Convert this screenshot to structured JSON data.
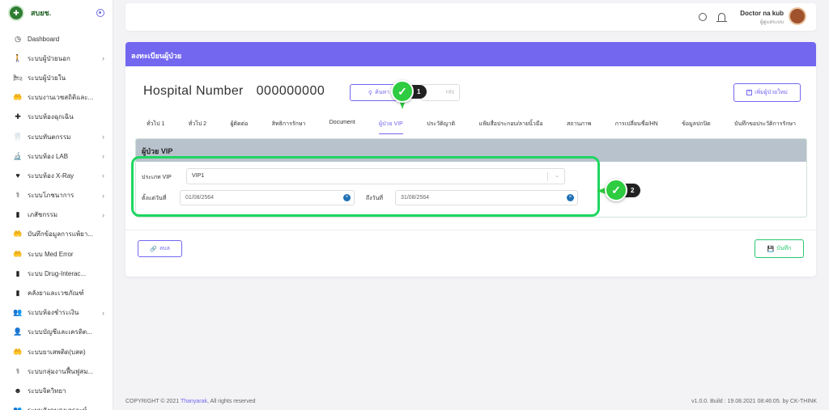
{
  "sidebar": {
    "brand": "สบยช.",
    "items": [
      {
        "icon": "◷",
        "icon_name": "clock-icon",
        "label": "Dashboard",
        "chevron": false
      },
      {
        "icon": "🚶",
        "icon_name": "walking-person-icon",
        "label": "ระบบผู้ป่วยนอก",
        "chevron": true
      },
      {
        "icon": "🛏",
        "icon_name": "bed-icon",
        "label": "ระบบผู้ป่วยใน",
        "chevron": false
      },
      {
        "icon": "🤲",
        "icon_name": "care-hands-icon",
        "label": "ระบบงานเวชสถิติและ...",
        "chevron": false
      },
      {
        "icon": "✚",
        "icon_name": "medical-cross-icon",
        "label": "ระบบห้องฉุกเฉิน",
        "chevron": false
      },
      {
        "icon": "🦷",
        "icon_name": "tooth-icon",
        "label": "ระบบทันตกรรม",
        "chevron": true
      },
      {
        "icon": "🔬",
        "icon_name": "microscope-icon",
        "label": "ระบบห้อง LAB",
        "chevron": true
      },
      {
        "icon": "♥",
        "icon_name": "heart-icon",
        "label": "ระบบห้อง X-Ray",
        "chevron": true
      },
      {
        "icon": "⚕",
        "icon_name": "nutrition-icon",
        "label": "ระบบโภชนาการ",
        "chevron": true
      },
      {
        "icon": "▮",
        "icon_name": "pill-bottle-icon",
        "label": "เภสัชกรรม",
        "chevron": true
      },
      {
        "icon": "🤲",
        "icon_name": "care-hands-icon",
        "label": "บันทึกข้อมูลการแพ้ยา...",
        "chevron": false
      },
      {
        "icon": "🤲",
        "icon_name": "care-hands-icon",
        "label": "ระบบ Med Error",
        "chevron": false
      },
      {
        "icon": "▮",
        "icon_name": "pill-bottle-icon",
        "label": "ระบบ Drug-Interac...",
        "chevron": false
      },
      {
        "icon": "▮",
        "icon_name": "pill-bottle-icon",
        "label": "คลังยาและเวชภัณฑ์",
        "chevron": false
      },
      {
        "icon": "👥",
        "icon_name": "people-icon",
        "label": "ระบบห้องชำระเงิน",
        "chevron": true
      },
      {
        "icon": "👤",
        "icon_name": "accountant-icon",
        "label": "ระบบบัญชีและเครดิต...",
        "chevron": false
      },
      {
        "icon": "🤲",
        "icon_name": "care-hands-icon",
        "label": "ระบบยาเสพติด(บสต)",
        "chevron": false
      },
      {
        "icon": "⚕",
        "icon_name": "rehab-icon",
        "label": "ระบบกลุ่มงานฟื้นฟูสม...",
        "chevron": false
      },
      {
        "icon": "☻",
        "icon_name": "head-icon",
        "label": "ระบบจิตวิทยา",
        "chevron": false
      },
      {
        "icon": "👥",
        "icon_name": "people-icon",
        "label": "ระบบสังคมสงเคราะห์",
        "chevron": false
      }
    ]
  },
  "topbar": {
    "user_name": "Doctor na kub",
    "user_role": "ผู้ดูแลระบบ"
  },
  "card": {
    "title": "ลงทะเบียนผู้ป่วย",
    "hn_label": "Hospital Number",
    "hn_value": "000000000",
    "search_label": "ค้นหา",
    "hn_button_label": "HN",
    "new_patient_label": "เพิ่มผู้ป่วยใหม่",
    "tabs": [
      {
        "label": "ทั่วไป 1",
        "active": false
      },
      {
        "label": "ทั่วไป 2",
        "active": false
      },
      {
        "label": "ผู้ติดต่อ",
        "active": false
      },
      {
        "label": "สิทธิการรักษา",
        "active": false
      },
      {
        "label": "Document",
        "active": false
      },
      {
        "label": "ผู้ป่วย VIP",
        "active": true
      },
      {
        "label": "ประวัติญาติ",
        "active": false
      },
      {
        "label": "แฟ้มสื่อประกอบ/ลายนิ้วมือ",
        "active": false
      },
      {
        "label": "สถานภาพ",
        "active": false
      },
      {
        "label": "การเปลี่ยนชื่อ/HN",
        "active": false
      },
      {
        "label": "ข้อมูลปกปิด",
        "active": false
      },
      {
        "label": "บันทึกขอประวัติการรักษา",
        "active": false
      }
    ],
    "vip": {
      "heading": "ผู้ป่วย VIP",
      "type_label": "ประเภท VIP",
      "type_value": "VIP1",
      "start_label": "ตั้งแต่วันที่",
      "start_value": "01/08/2564",
      "end_label": "ถึงวันที่",
      "end_value": "31/08/2564"
    },
    "clear_label": "ลบล",
    "save_label": "บันทึก"
  },
  "annotations": {
    "badge1": "1",
    "badge2": "2",
    "highlight_color": "#1ed760"
  },
  "footer": {
    "copyright_prefix": "COPYRIGHT © 2021 ",
    "copyright_brand": "Thanyarak",
    "copyright_suffix": ", All rights reserved",
    "version": "v1.0.0. Build : 19.08.2021 08:46:05. by CK-THINK"
  },
  "colors": {
    "accent": "#7367f0",
    "success": "#28c76f",
    "panel_header": "#b8c2cc"
  }
}
